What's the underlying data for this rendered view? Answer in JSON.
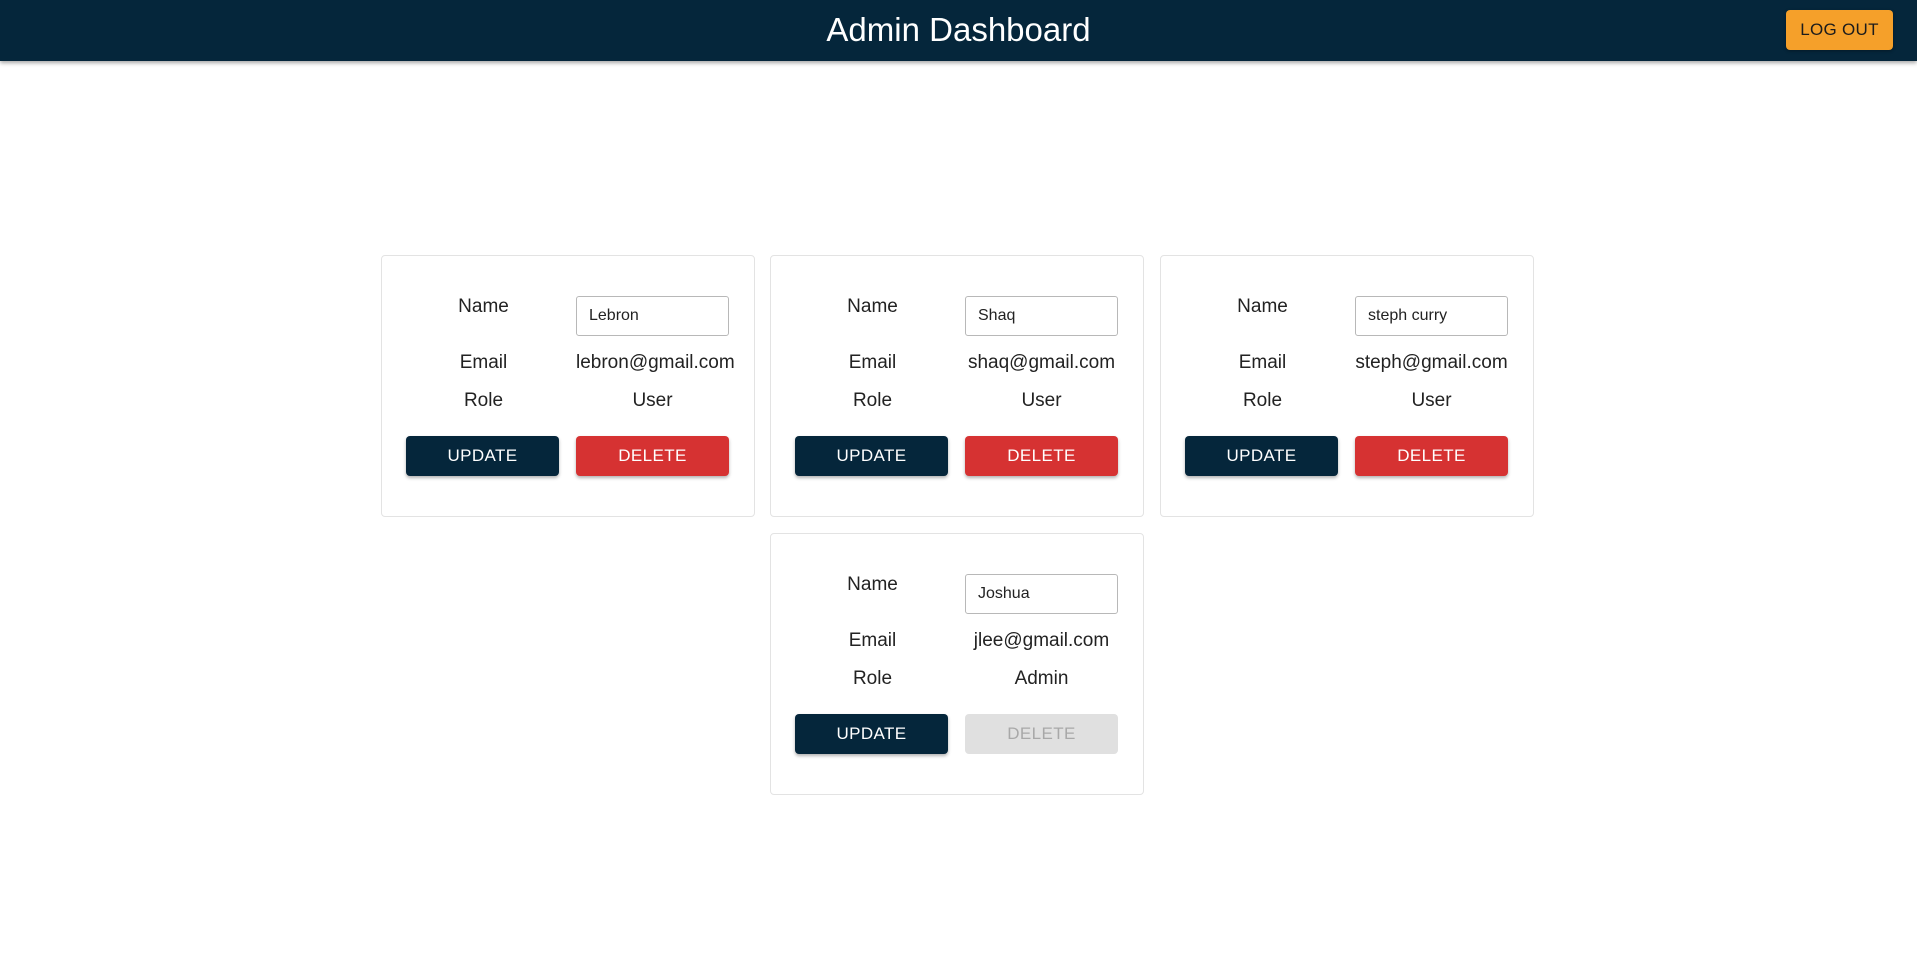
{
  "header": {
    "title": "Admin Dashboard",
    "logout_label": "LOG OUT"
  },
  "labels": {
    "name": "Name",
    "email": "Email",
    "role": "Role",
    "update": "UPDATE",
    "delete": "DELETE"
  },
  "users": [
    {
      "name": "Lebron",
      "email": "lebron@gmail.com",
      "role": "User",
      "delete_enabled": true
    },
    {
      "name": "Shaq",
      "email": "shaq@gmail.com",
      "role": "User",
      "delete_enabled": true
    },
    {
      "name": "steph curry",
      "email": "steph@gmail.com",
      "role": "User",
      "delete_enabled": true
    },
    {
      "name": "Joshua",
      "email": "jlee@gmail.com",
      "role": "Admin",
      "delete_enabled": false
    }
  ],
  "colors": {
    "header_bg": "#05263b",
    "logout_bg": "#f5a02a",
    "update_bg": "#05263b",
    "delete_bg": "#d63232",
    "delete_disabled_bg": "#e0e0e0"
  }
}
